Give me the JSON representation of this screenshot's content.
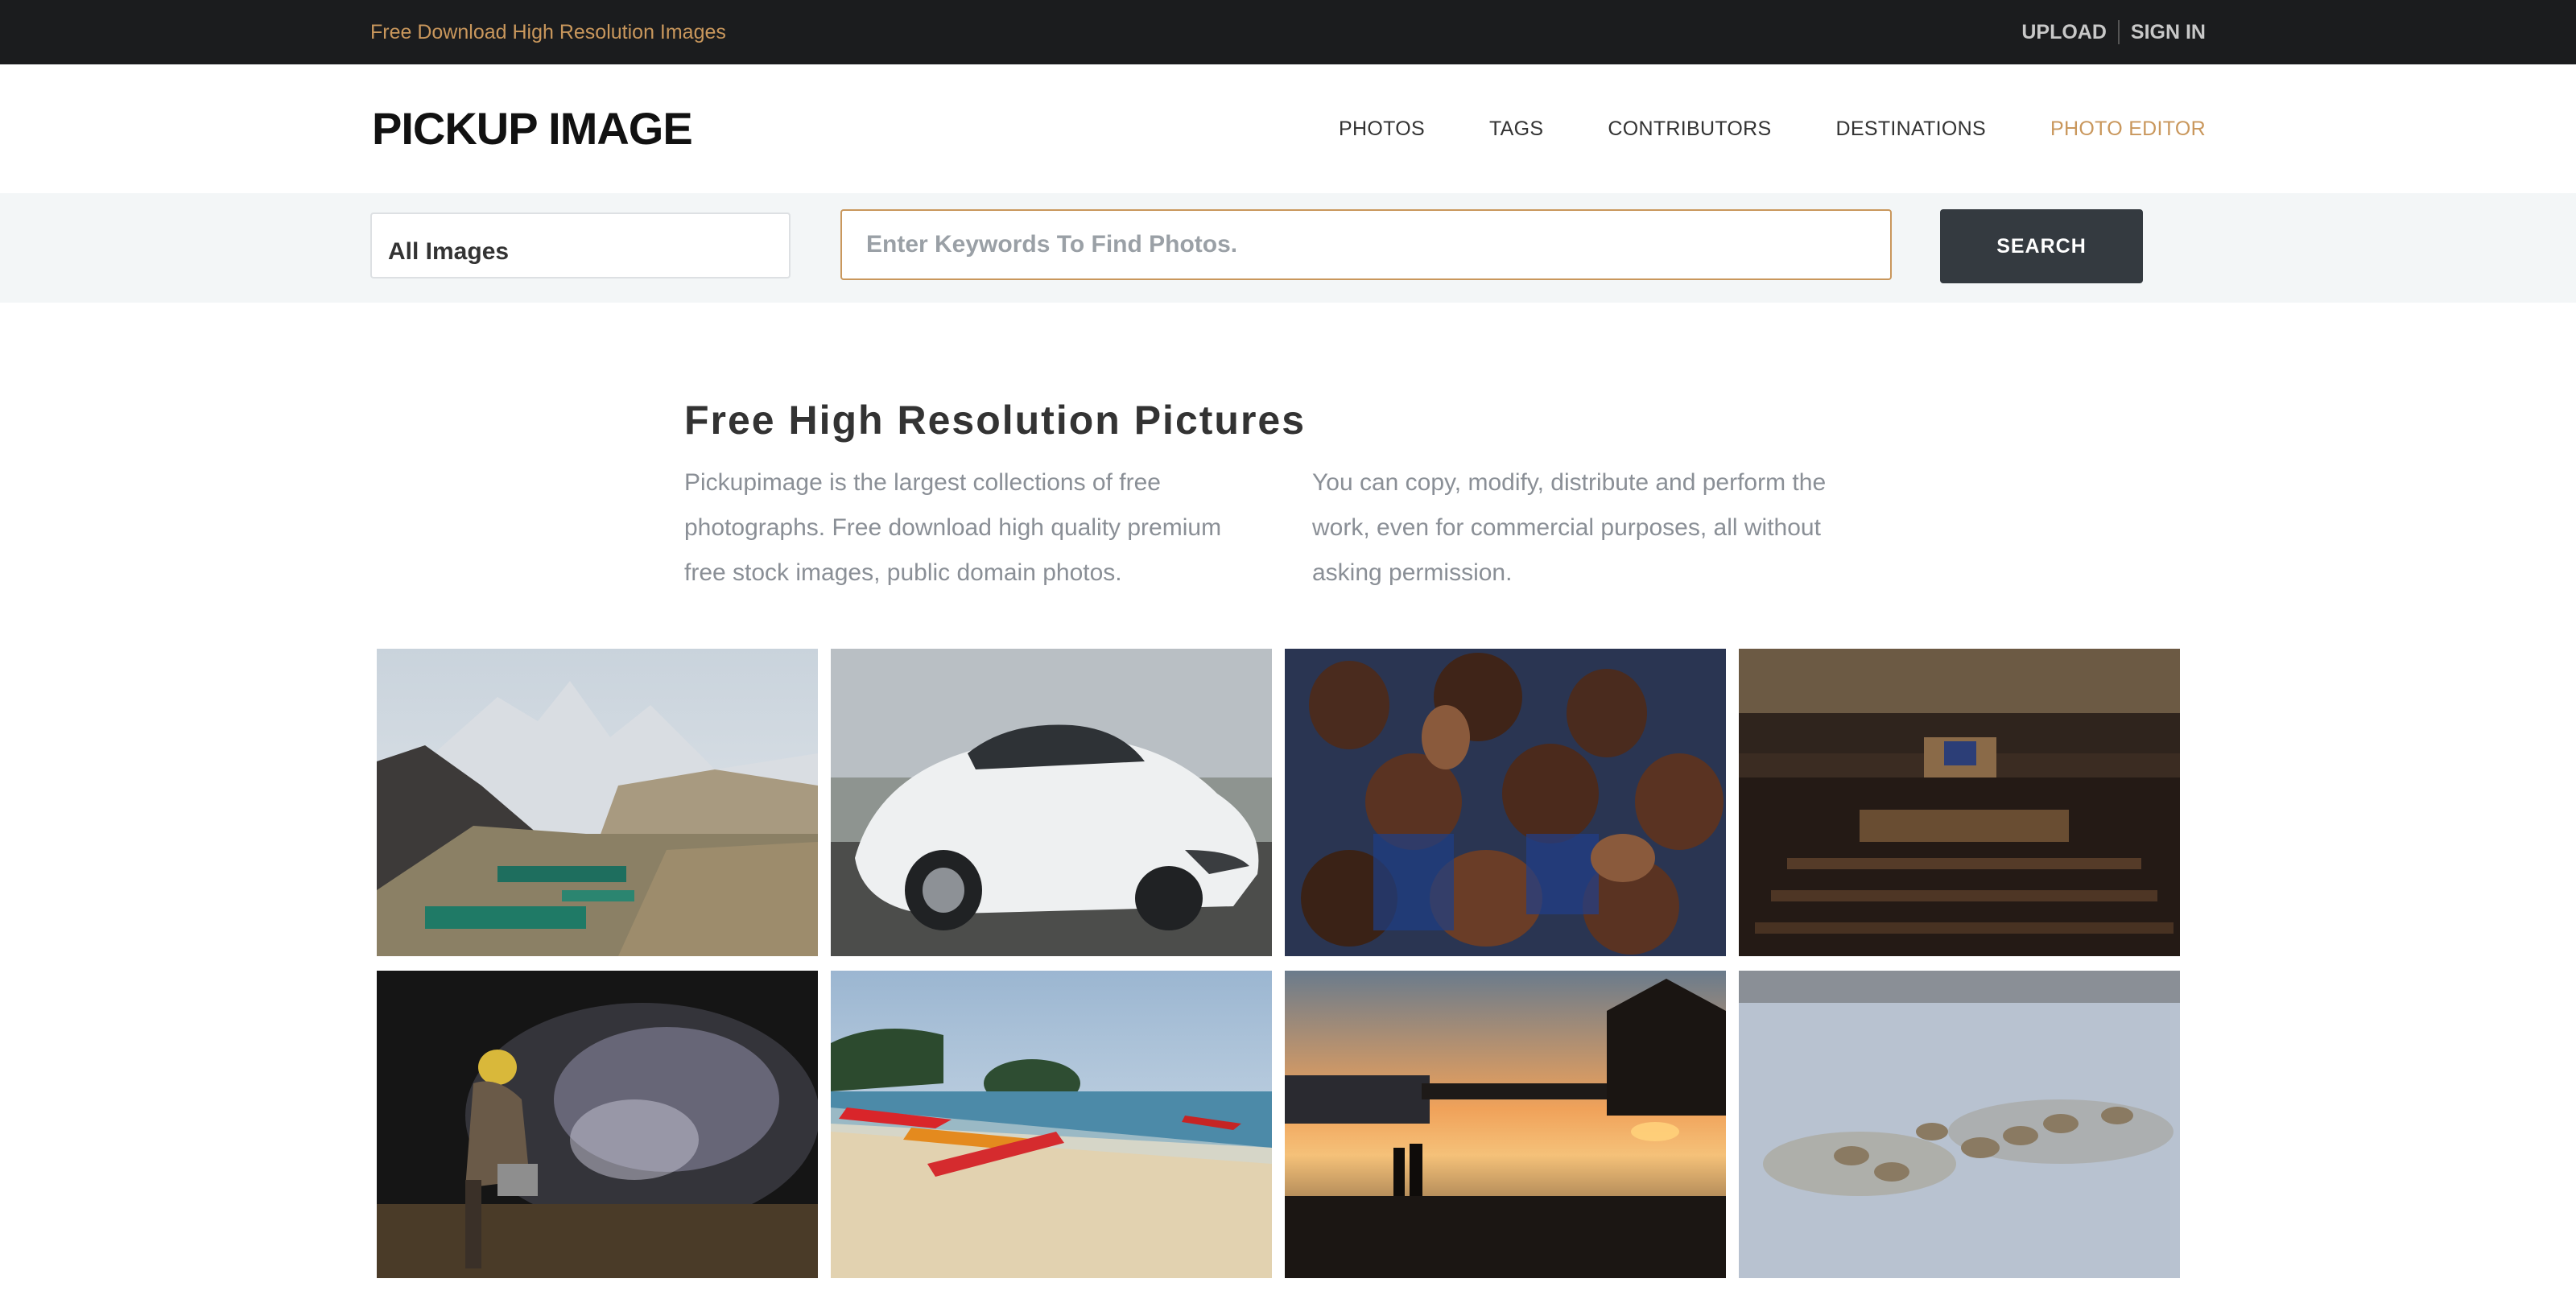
{
  "topbar": {
    "tagline": "Free Download High Resolution Images",
    "upload": "UPLOAD",
    "signin": "SIGN IN"
  },
  "header": {
    "logo": "PICKUP IMAGE",
    "nav": [
      "PHOTOS",
      "TAGS",
      "CONTRIBUTORS",
      "DESTINATIONS",
      "PHOTO EDITOR"
    ]
  },
  "search": {
    "category": "All Images",
    "placeholder": "Enter Keywords To Find Photos.",
    "button": "SEARCH"
  },
  "intro": {
    "title": "Free High Resolution Pictures",
    "left": "Pickupimage is the largest collections of free photographs. Free download high quality premium free stock images, public domain photos.",
    "right": "You can copy, modify, distribute and perform the work, even for commercial purposes, all without asking permission."
  },
  "colors": {
    "accent": "#c9975c",
    "topbar": "#1b1c1e",
    "search_button": "#343a40",
    "search_strip": "#f3f6f7"
  }
}
